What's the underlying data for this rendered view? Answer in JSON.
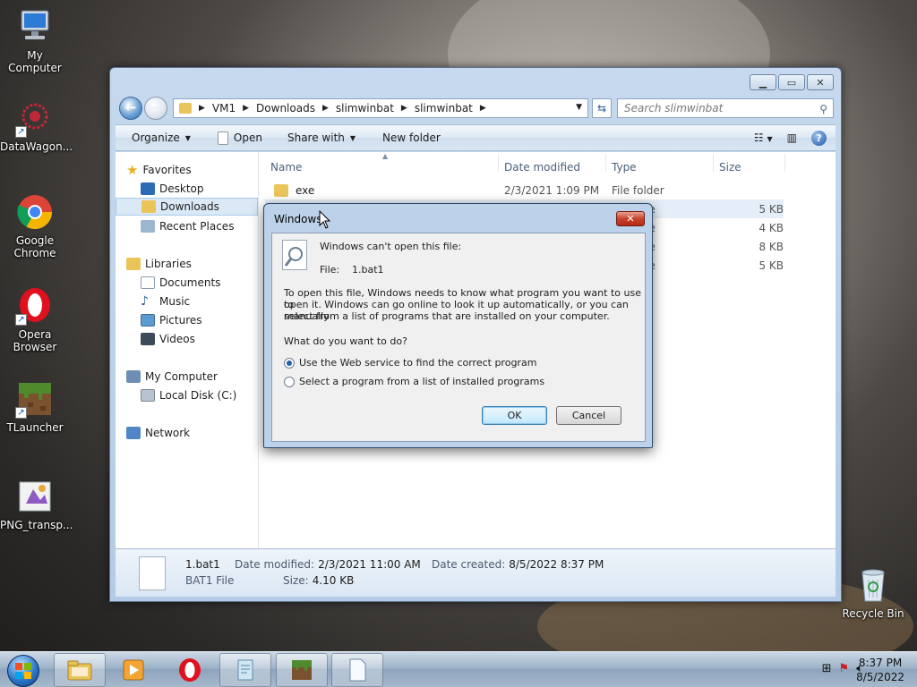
{
  "desktop": {
    "icons": [
      {
        "label": "My Computer",
        "icon": "computer-icon"
      },
      {
        "label": "DataWagon...",
        "icon": "datawagon-icon"
      },
      {
        "label": "Google Chrome",
        "icon": "chrome-icon"
      },
      {
        "label": "Opera Browser",
        "icon": "opera-icon"
      },
      {
        "label": "TLauncher",
        "icon": "minecraft-grass-block-icon"
      },
      {
        "label": "PNG_transp...",
        "icon": "png-image-icon"
      },
      {
        "label": "Recycle Bin",
        "icon": "recycle-bin-icon"
      }
    ]
  },
  "explorer": {
    "breadcrumbs": [
      "VM1",
      "Downloads",
      "slimwinbat",
      "slimwinbat"
    ],
    "search_placeholder": "Search slimwinbat",
    "toolbar": {
      "organize": "Organize",
      "open": "Open",
      "share_with": "Share with",
      "new_folder": "New folder"
    },
    "nav": {
      "favorites": "Favorites",
      "desktop": "Desktop",
      "downloads": "Downloads",
      "recent_places": "Recent Places",
      "libraries": "Libraries",
      "documents": "Documents",
      "music": "Music",
      "pictures": "Pictures",
      "videos": "Videos",
      "my_computer": "My Computer",
      "local_disk": "Local Disk (C:)",
      "network": "Network"
    },
    "columns": {
      "name": "Name",
      "date_modified": "Date modified",
      "type": "Type",
      "size": "Size"
    },
    "files": [
      {
        "name": "exe",
        "date": "2/3/2021 1:09 PM",
        "type": "File folder",
        "size": ""
      },
      {
        "name": "",
        "date": "",
        "type": "le",
        "size": "5 KB"
      },
      {
        "name": "",
        "date": "",
        "type": "le",
        "size": "4 KB"
      },
      {
        "name": "",
        "date": "",
        "type": "le",
        "size": "8 KB"
      },
      {
        "name": "",
        "date": "",
        "type": "le",
        "size": "5 KB"
      }
    ],
    "details": {
      "file_name": "1.bat1",
      "file_type": "BAT1 File",
      "date_modified_label": "Date modified:",
      "date_modified": "2/3/2021 11:00 AM",
      "size_label": "Size:",
      "size": "4.10 KB",
      "date_created_label": "Date created:",
      "date_created": "8/5/2022 8:37 PM"
    }
  },
  "dialog": {
    "title": "Windows",
    "heading": "Windows can't open this file:",
    "file_label": "File:",
    "file_name": "1.bat1",
    "body_line1": "To open this file, Windows needs to know what program you want to use to",
    "body_line2": "open it. Windows can go online to look it up automatically, or you can manually",
    "body_line3": "select from a list of programs that are installed on your computer.",
    "question": "What do you want to do?",
    "option_web": "Use the Web service to find the correct program",
    "option_list": "Select a program from a list of installed programs",
    "selected_option": "web",
    "ok": "OK",
    "cancel": "Cancel"
  },
  "taskbar": {
    "time": "8:37 PM",
    "date": "8/5/2022"
  }
}
